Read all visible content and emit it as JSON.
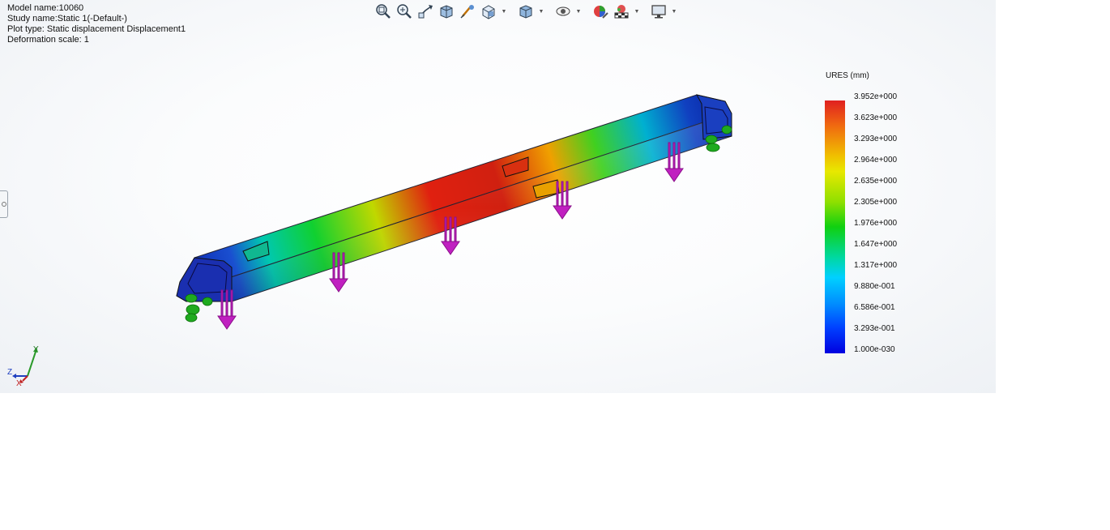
{
  "info": {
    "model_name": "Model name:10060",
    "study_name": "Study name:Static 1(-Default-)",
    "plot_type": "Plot type: Static displacement Displacement1",
    "deformation_scale": "Deformation scale: 1"
  },
  "toolbar": [
    {
      "icon": "zoom-to-fit-icon"
    },
    {
      "icon": "zoom-to-area-icon"
    },
    {
      "icon": "previous-view-icon"
    },
    {
      "icon": "section-view-icon"
    },
    {
      "icon": "dynamic-annotation-icon"
    },
    {
      "icon": "view-orientation-icon",
      "caret": true
    },
    {
      "icon": "display-style-icon",
      "caret": true
    },
    {
      "icon": "hide-show-icon",
      "caret": true
    },
    {
      "icon": "edit-appearance-icon"
    },
    {
      "icon": "apply-scene-icon",
      "caret": true
    },
    {
      "icon": "view-settings-icon",
      "caret": true
    }
  ],
  "legend": {
    "title": "URES (mm)",
    "labels": [
      "3.952e+000",
      "3.623e+000",
      "3.293e+000",
      "2.964e+000",
      "2.635e+000",
      "2.305e+000",
      "1.976e+000",
      "1.647e+000",
      "1.317e+000",
      "9.880e-001",
      "6.586e-001",
      "3.293e-001",
      "1.000e-030"
    ]
  },
  "triad": {
    "x": "X",
    "y": "Y",
    "z": "Z"
  },
  "colors": {
    "high": "#e02020",
    "low": "#0000e0",
    "fixture": "#1faa1f",
    "load": "#b020b0"
  }
}
